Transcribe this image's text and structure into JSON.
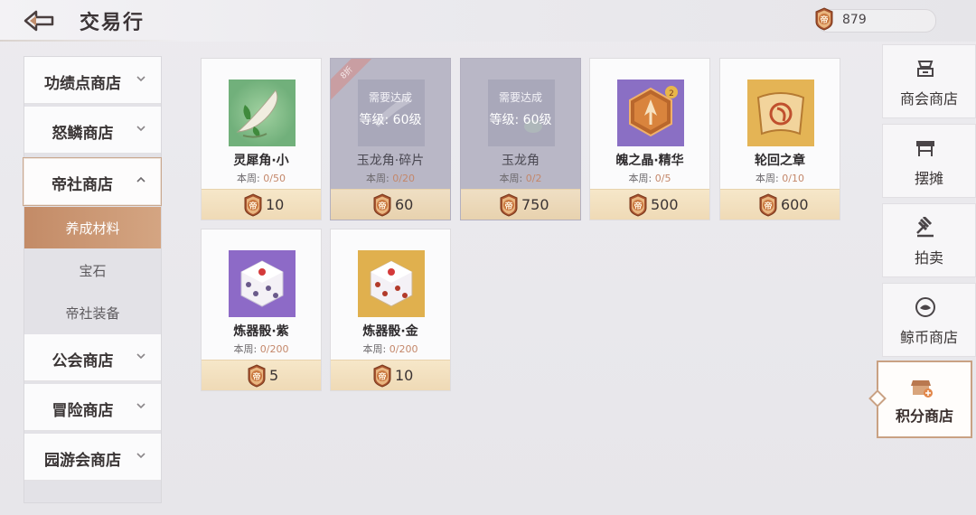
{
  "header": {
    "title": "交易行",
    "currency_amount": "879",
    "currency_symbol": "帝"
  },
  "categories": [
    {
      "label": "功绩点商店"
    },
    {
      "label": "怒鳞商店"
    },
    {
      "label": "帝社商店",
      "expanded": true
    },
    {
      "label": "公会商店"
    },
    {
      "label": "冒险商店"
    },
    {
      "label": "园游会商店"
    }
  ],
  "subcategories": [
    {
      "label": "养成材料",
      "selected": true
    },
    {
      "label": "宝石"
    },
    {
      "label": "帝社装备"
    }
  ],
  "items": [
    {
      "name": "灵犀角·小",
      "limit_prefix": "本周: ",
      "limit": "0/50",
      "price": "10",
      "icon": "horn-plant-icon"
    },
    {
      "name": "玉龙角·碎片",
      "limit_prefix": "本周: ",
      "limit": "0/20",
      "price": "60",
      "locked": true,
      "ribbon": "8折",
      "need_text": "需要达成",
      "level_text": "等级: 60级",
      "icon": "jade-horn-shard-icon"
    },
    {
      "name": "玉龙角",
      "limit_prefix": "本周: ",
      "limit": "0/2",
      "price": "750",
      "locked": true,
      "need_text": "需要达成",
      "level_text": "等级: 60级",
      "icon": "jade-horn-icon"
    },
    {
      "name": "魄之晶·精华",
      "limit_prefix": "本周: ",
      "limit": "0/5",
      "price": "500",
      "icon": "soul-crystal-icon"
    },
    {
      "name": "轮回之章",
      "limit_prefix": "本周: ",
      "limit": "0/10",
      "price": "600",
      "icon": "reincarnation-scroll-icon"
    },
    {
      "name": "炼器骰·紫",
      "limit_prefix": "本周: ",
      "limit": "0/200",
      "price": "5",
      "icon": "purple-dice-icon"
    },
    {
      "name": "炼器骰·金",
      "limit_prefix": "本周: ",
      "limit": "0/200",
      "price": "10",
      "icon": "gold-dice-icon"
    }
  ],
  "right_nav": [
    {
      "label": "商会商店",
      "icon": "merchant-icon"
    },
    {
      "label": "摆摊",
      "icon": "stall-icon"
    },
    {
      "label": "拍卖",
      "icon": "gavel-icon"
    },
    {
      "label": "鲸币商店",
      "icon": "whale-coin-icon"
    },
    {
      "label": "积分商店",
      "icon": "points-shop-icon",
      "selected": true
    }
  ],
  "colors": {
    "accent": "#c9a183",
    "selected_tab": "#c38b67",
    "price_bar": "#f3e2c0",
    "limit_count": "#c4876a"
  }
}
